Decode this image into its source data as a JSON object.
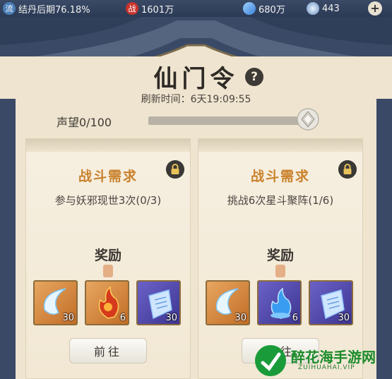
{
  "status": {
    "realm": "结丹后期76.18%",
    "realm_icon": "流",
    "combat_icon": "战",
    "combat_value": "1601万",
    "spirit_value": "680万",
    "coin_value": "443",
    "plus": "+"
  },
  "header": {
    "title": "仙门令",
    "help": "?",
    "refresh": "刷新时间：6天19:09:55",
    "reputation_label": "声望0/100",
    "reputation_fraction": 0.0
  },
  "cards": [
    {
      "title": "战斗需求",
      "requirement": "参与妖邪现世3次(0/3)",
      "reward_title": "奖励",
      "items": [
        {
          "icon": "crescent-blade-icon",
          "count": "30"
        },
        {
          "icon": "fire-flower-icon",
          "count": "6"
        },
        {
          "icon": "spirit-scroll-icon",
          "count": "30"
        }
      ],
      "button": "前往"
    },
    {
      "title": "战斗需求",
      "requirement": "挑战6次星斗聚阵(1/6)",
      "reward_title": "奖励",
      "items": [
        {
          "icon": "crescent-blade-icon",
          "count": "30"
        },
        {
          "icon": "water-flame-icon",
          "count": "6"
        },
        {
          "icon": "spirit-scroll-icon",
          "count": "30"
        }
      ],
      "button": "前往"
    }
  ],
  "watermark": {
    "name": "醉花海手游网",
    "url": "ZUIHUAHAI.VIP"
  },
  "colors": {
    "title_orange": "#c9812b",
    "frame_blue": "#394966",
    "parchment": "#efe4cf"
  }
}
